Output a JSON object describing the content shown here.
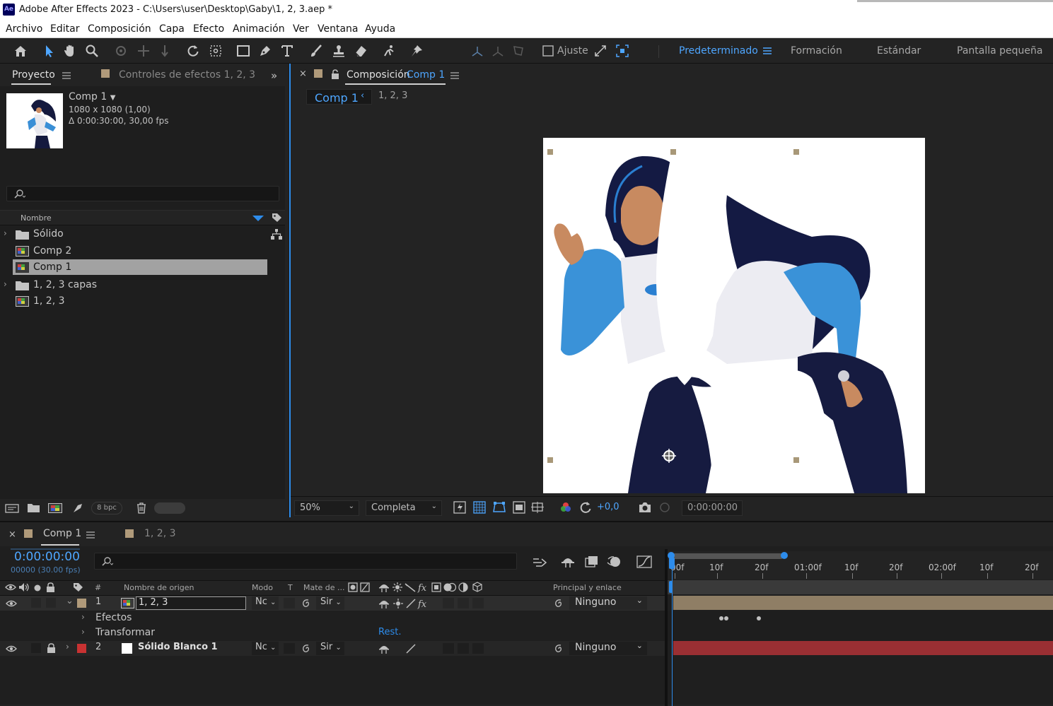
{
  "app": {
    "logo": "Ae",
    "title": "Adobe After Effects 2023 - C:\\Users\\user\\Desktop\\Gaby\\1, 2, 3.aep *"
  },
  "menu": [
    "Archivo",
    "Editar",
    "Composición",
    "Capa",
    "Efecto",
    "Animación",
    "Ver",
    "Ventana",
    "Ayuda"
  ],
  "toolbar": {
    "snap_label": "Ajuste",
    "workspaces": [
      "Predeterminado",
      "Formación",
      "Estándar",
      "Pantalla pequeña"
    ],
    "active_workspace": "Predeterminado",
    "accent": "#4ea6ff"
  },
  "project": {
    "tab_project": "Proyecto",
    "tab_effects": "Controles de efectos 1, 2, 3",
    "selected_name": "Comp 1",
    "selected_dims": "1080 x 1080 (1,00)",
    "selected_duration": "Δ 0:00:30:00, 30,00 fps",
    "column_name": "Nombre",
    "items": [
      {
        "label": "Sólido",
        "type": "folder",
        "icon": "folder-icon",
        "expandable": true
      },
      {
        "label": "Comp 2",
        "type": "comp",
        "icon": "composition-icon",
        "expandable": false
      },
      {
        "label": "Comp 1",
        "type": "comp",
        "icon": "composition-icon",
        "expandable": false,
        "selected": true
      },
      {
        "label": "1, 2, 3 capas",
        "type": "folder",
        "icon": "folder-icon",
        "expandable": true
      },
      {
        "label": "1, 2, 3",
        "type": "comp",
        "icon": "composition-icon",
        "expandable": false
      }
    ],
    "bpc": "8 bpc"
  },
  "composition": {
    "tab_prefix": "Composición",
    "tab_comp": "Comp 1",
    "breadcrumb_active": "Comp 1",
    "breadcrumb_next": "1, 2, 3",
    "zoom": "50%",
    "resolution": "Completa",
    "exposure": "+0,0",
    "timecode": "0:00:00:00"
  },
  "timeline": {
    "tab_comp1": "Comp 1",
    "tab_other": "1, 2, 3",
    "timecode": "0:00:00:00",
    "frame_info": "00000 (30.00 fps)",
    "columns": {
      "number": "#",
      "source_name": "Nombre de origen",
      "mode": "Modo",
      "t": "T",
      "matte": "Mate de ...",
      "parent": "Principal y enlace"
    },
    "layers": [
      {
        "number": "1",
        "name": "1, 2, 3",
        "mode": "Nc",
        "matte": "Sir",
        "parent": "Ninguno",
        "label_color": "#b09a7a",
        "bar_color": "#8f7e65",
        "selected": true
      },
      {
        "number": "2",
        "name": "Sólido Blanco 1",
        "mode": "Nc",
        "matte": "Sir",
        "parent": "Ninguno",
        "label_color": "#c83232",
        "bar_color": "#9a2f33",
        "selected": false
      }
    ],
    "sub_effects": "Efectos",
    "sub_transform": "Transformar",
    "reset": "Rest.",
    "ruler_labels": [
      "00f",
      "10f",
      "20f",
      "01:00f",
      "10f",
      "20f",
      "02:00f",
      "10f",
      "20f"
    ]
  }
}
